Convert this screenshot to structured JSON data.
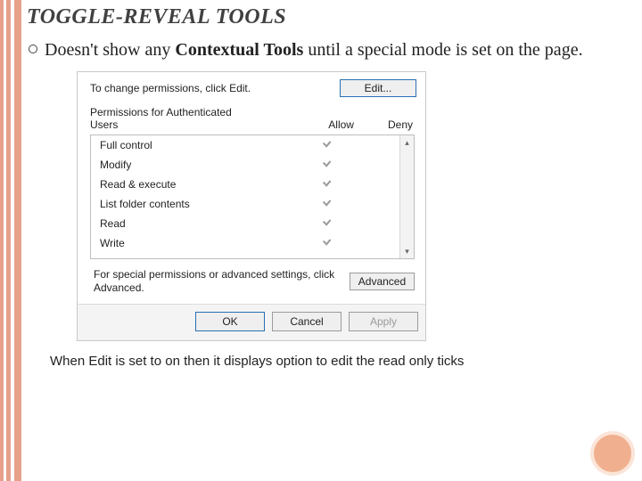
{
  "slide": {
    "title": "TOGGLE-REVEAL TOOLS",
    "bullet_pre": "Doesn't show any ",
    "bullet_bold": "Contextual Tools",
    "bullet_post": " until a special mode is set on the page.",
    "caption": "When Edit is set to on then it displays option to edit the read only ticks"
  },
  "dialog": {
    "edit_hint": "To change permissions, click Edit.",
    "edit_btn": "Edit...",
    "perm_for_line1": "Permissions for Authenticated",
    "perm_for_line2": "Users",
    "col_allow": "Allow",
    "col_deny": "Deny",
    "perms": [
      {
        "label": "Full control",
        "allow": true
      },
      {
        "label": "Modify",
        "allow": true
      },
      {
        "label": "Read & execute",
        "allow": true
      },
      {
        "label": "List folder contents",
        "allow": true
      },
      {
        "label": "Read",
        "allow": true
      },
      {
        "label": "Write",
        "allow": true
      }
    ],
    "adv_text": "For special permissions or advanced settings, click Advanced.",
    "adv_btn": "Advanced",
    "ok": "OK",
    "cancel": "Cancel",
    "apply": "Apply"
  }
}
